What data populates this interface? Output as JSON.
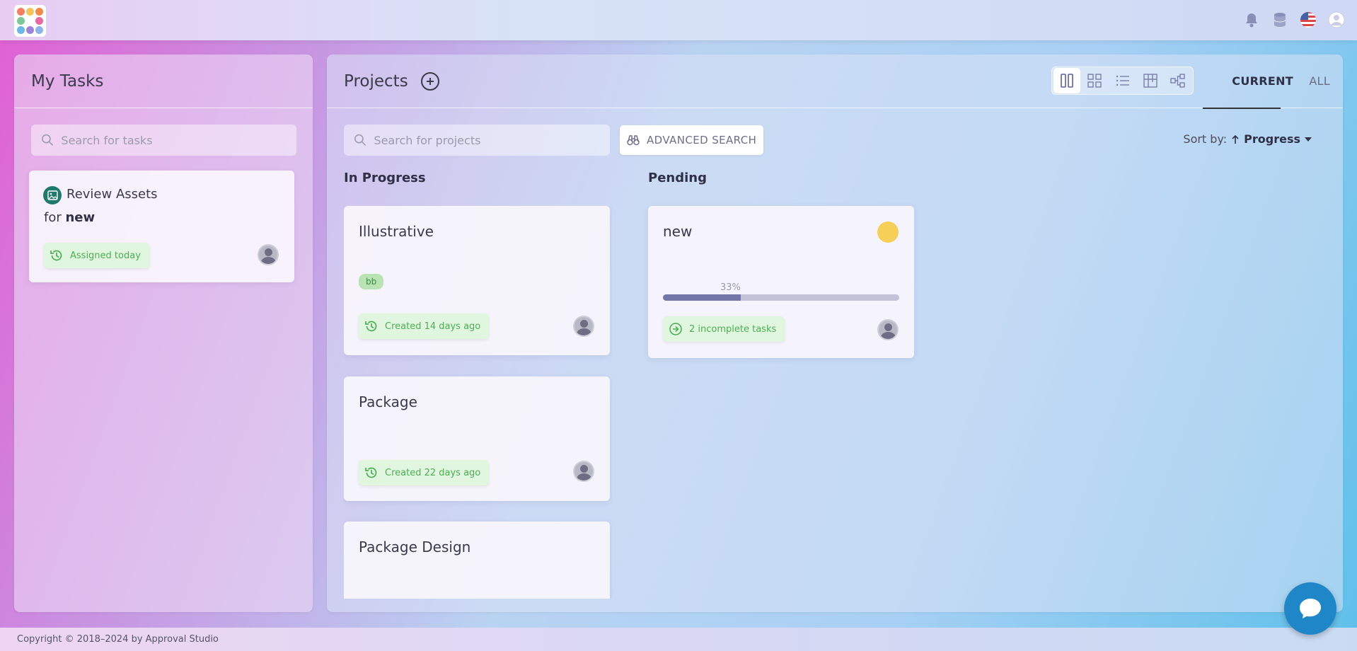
{
  "header": {
    "icons": [
      "bell-icon",
      "database-icon",
      "us-flag-icon",
      "user-icon"
    ]
  },
  "tasks_panel": {
    "title": "My Tasks",
    "search_placeholder": "Search for tasks",
    "task_card": {
      "title": "Review Assets",
      "for_label": "for",
      "project": "new",
      "status": "Assigned today"
    }
  },
  "projects_panel": {
    "title": "Projects",
    "search_placeholder": "Search for projects",
    "advanced_search_label": "ADVANCED SEARCH",
    "tabs": {
      "current": "CURRENT",
      "all": "ALL"
    },
    "sort_label": "Sort by:",
    "sort_value": "Progress",
    "columns": [
      {
        "title": "In Progress",
        "cards": [
          {
            "title": "Illustrative",
            "tag": "bb",
            "status": "Created 14 days ago"
          },
          {
            "title": "Package",
            "status": "Created 22 days ago"
          },
          {
            "title": "Package Design"
          }
        ]
      },
      {
        "title": "Pending",
        "cards": [
          {
            "title": "new",
            "progress_label": "33%",
            "progress": 0.33,
            "status": "2 incomplete tasks",
            "dot_color": "#f6cf58"
          }
        ]
      }
    ]
  },
  "footer": {
    "copyright": "Copyright © 2018–2024 by Approval Studio"
  },
  "colors": {
    "accent": "#7276a8",
    "chip_bg": "#e1f6df",
    "chip_text": "#4cae54",
    "chat": "#1f86c7"
  }
}
